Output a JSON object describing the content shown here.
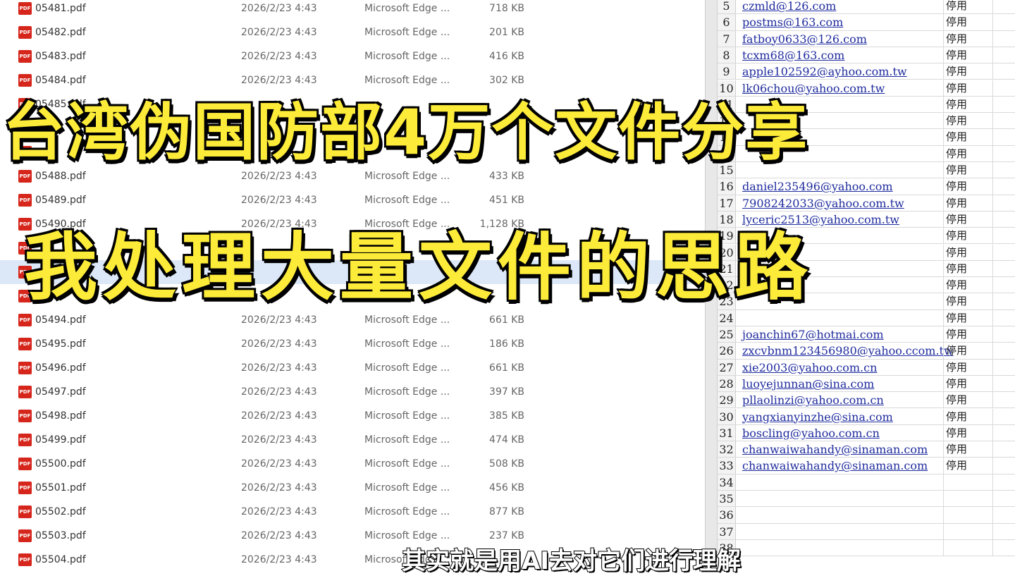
{
  "explorer": {
    "files": [
      {
        "name": "05481.pdf",
        "date": "2026/2/23 4:43",
        "type": "Microsoft Edge ...",
        "size": "718 KB"
      },
      {
        "name": "05482.pdf",
        "date": "2026/2/23 4:43",
        "type": "Microsoft Edge ...",
        "size": "201 KB"
      },
      {
        "name": "05483.pdf",
        "date": "2026/2/23 4:43",
        "type": "Microsoft Edge ...",
        "size": "416 KB"
      },
      {
        "name": "05484.pdf",
        "date": "2026/2/23 4:43",
        "type": "Microsoft Edge ...",
        "size": "302 KB"
      },
      {
        "name": "05485.pdf",
        "date": "",
        "type": "",
        "size": ""
      },
      {
        "name": "",
        "date": "",
        "type": "",
        "size": ""
      },
      {
        "name": "",
        "date": "",
        "type": "",
        "size": ""
      },
      {
        "name": "05488.pdf",
        "date": "2026/2/23 4:43",
        "type": "Microsoft Edge ...",
        "size": "433 KB"
      },
      {
        "name": "05489.pdf",
        "date": "2026/2/23 4:43",
        "type": "Microsoft Edge ...",
        "size": "451 KB"
      },
      {
        "name": "05490.pdf",
        "date": "2026/2/23 4:43",
        "type": "Microsoft Edge ...",
        "size": "1,128 KB"
      },
      {
        "name": "",
        "date": "",
        "type": "",
        "size": ""
      },
      {
        "name": "",
        "date": "",
        "type": "",
        "size": ""
      },
      {
        "name": "",
        "date": "",
        "type": "",
        "size": ""
      },
      {
        "name": "05494.pdf",
        "date": "2026/2/23 4:43",
        "type": "Microsoft Edge ...",
        "size": "661 KB"
      },
      {
        "name": "05495.pdf",
        "date": "2026/2/23 4:43",
        "type": "Microsoft Edge ...",
        "size": "186 KB"
      },
      {
        "name": "05496.pdf",
        "date": "2026/2/23 4:43",
        "type": "Microsoft Edge ...",
        "size": "661 KB"
      },
      {
        "name": "05497.pdf",
        "date": "2026/2/23 4:43",
        "type": "Microsoft Edge ...",
        "size": "397 KB"
      },
      {
        "name": "05498.pdf",
        "date": "2026/2/23 4:43",
        "type": "Microsoft Edge ...",
        "size": "385 KB"
      },
      {
        "name": "05499.pdf",
        "date": "2026/2/23 4:43",
        "type": "Microsoft Edge ...",
        "size": "474 KB"
      },
      {
        "name": "05500.pdf",
        "date": "2026/2/23 4:43",
        "type": "Microsoft Edge ...",
        "size": "508 KB"
      },
      {
        "name": "05501.pdf",
        "date": "2026/2/23 4:43",
        "type": "Microsoft Edge ...",
        "size": "456 KB"
      },
      {
        "name": "05502.pdf",
        "date": "2026/2/23 4:43",
        "type": "Microsoft Edge ...",
        "size": "877 KB"
      },
      {
        "name": "05503.pdf",
        "date": "2026/2/23 4:43",
        "type": "Microsoft Edge ...",
        "size": "237 KB"
      },
      {
        "name": "05504.pdf",
        "date": "2026/2/23 4:43",
        "type": "Microsoft Edge ...",
        "size": ""
      }
    ],
    "icon_label": "PDF"
  },
  "sheet": {
    "rows": [
      {
        "num": "5",
        "email": "czmld@126.com",
        "status": "停用"
      },
      {
        "num": "6",
        "email": "postms@163.com",
        "status": "停用"
      },
      {
        "num": "7",
        "email": "fatboy0633@126.com",
        "status": "停用"
      },
      {
        "num": "8",
        "email": "tcxm68@163.com",
        "status": "停用"
      },
      {
        "num": "9",
        "email": "apple102592@ayhoo.com.tw",
        "status": "停用"
      },
      {
        "num": "10",
        "email": "lk06chou@yahoo.com.tw",
        "status": "停用"
      },
      {
        "num": "11",
        "email": "",
        "status": "停用"
      },
      {
        "num": "12",
        "email": "",
        "status": "停用"
      },
      {
        "num": "13",
        "email": "",
        "status": "停用"
      },
      {
        "num": "14",
        "email": "",
        "status": "停用"
      },
      {
        "num": "15",
        "email": "",
        "status": "停用"
      },
      {
        "num": "16",
        "email": "daniel235496@yahoo.com",
        "status": "停用"
      },
      {
        "num": "17",
        "email": "7908242033@yahoo.com.tw",
        "status": "停用"
      },
      {
        "num": "18",
        "email": "lyceric2513@yahoo.com.tw",
        "status": "停用"
      },
      {
        "num": "19",
        "email": "",
        "status": "停用"
      },
      {
        "num": "20",
        "email": "",
        "status": "停用"
      },
      {
        "num": "21",
        "email": "",
        "status": "停用"
      },
      {
        "num": "22",
        "email": "",
        "status": "停用"
      },
      {
        "num": "23",
        "email": "",
        "status": "停用"
      },
      {
        "num": "24",
        "email": "",
        "status": "停用"
      },
      {
        "num": "25",
        "email": "joanchin67@hotmai.com",
        "status": "停用"
      },
      {
        "num": "26",
        "email": "zxcvbnm123456980@yahoo.ccom.tw",
        "status": "停用"
      },
      {
        "num": "27",
        "email": "xie2003@yahoo.com.cn",
        "status": "停用"
      },
      {
        "num": "28",
        "email": "luoyejunnan@sina.com",
        "status": "停用"
      },
      {
        "num": "29",
        "email": "pllaolinzi@yahoo.com.cn",
        "status": "停用"
      },
      {
        "num": "30",
        "email": "yangxianyinzhe@sina.com",
        "status": "停用"
      },
      {
        "num": "31",
        "email": "boscling@yahoo.com.cn",
        "status": "停用"
      },
      {
        "num": "32",
        "email": "chanwaiwahandy@sinaman.com",
        "status": "停用"
      },
      {
        "num": "33",
        "email": "chanwaiwahandy@sinaman.com",
        "status": "停用"
      },
      {
        "num": "34",
        "email": "",
        "status": ""
      },
      {
        "num": "35",
        "email": "",
        "status": ""
      },
      {
        "num": "36",
        "email": "",
        "status": ""
      },
      {
        "num": "37",
        "email": "",
        "status": ""
      },
      {
        "num": "38",
        "email": "",
        "status": ""
      }
    ]
  },
  "overlay": {
    "title_line1": "台湾伪国防部4万个文件分享",
    "title_line2": "我处理大量文件的思路",
    "subtitle": "其实就是用AI去对它们进行理解"
  },
  "colors": {
    "title_fill": "#fdeb3a",
    "title_stroke": "#000000",
    "pdf_icon": "#d6261c",
    "link": "#1f2c9e"
  }
}
